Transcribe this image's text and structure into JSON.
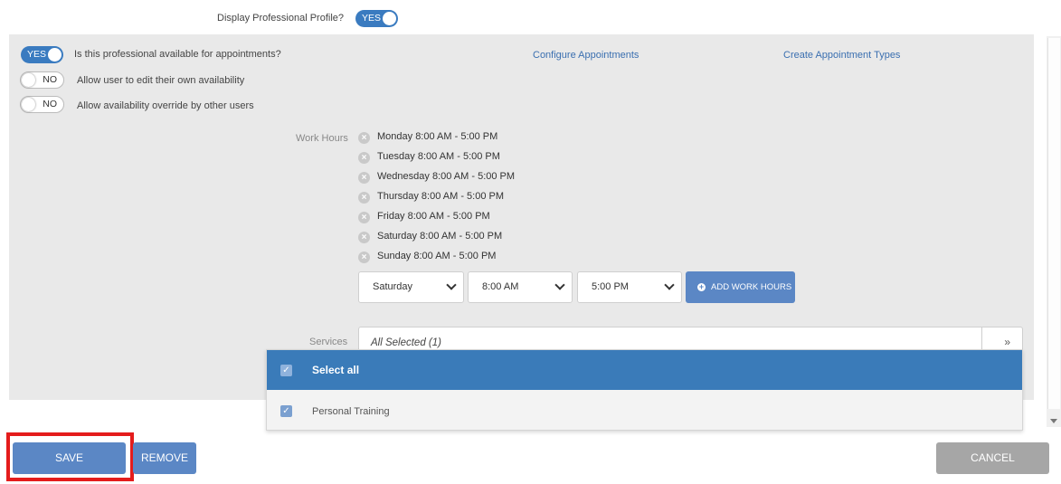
{
  "profile": {
    "display_label": "Display Professional Profile?",
    "display_toggle": "YES"
  },
  "availability": {
    "available_toggle": "YES",
    "available_label": "Is this professional available for appointments?",
    "edit_toggle": "NO",
    "edit_label": "Allow user to edit their own availability",
    "override_toggle": "NO",
    "override_label": "Allow availability override by other users",
    "configure_link": "Configure Appointments",
    "create_types_link": "Create Appointment Types"
  },
  "work_hours": {
    "label": "Work Hours",
    "entries": [
      "Monday 8:00 AM - 5:00 PM",
      "Tuesday 8:00 AM - 5:00 PM",
      "Wednesday 8:00 AM - 5:00 PM",
      "Thursday 8:00 AM - 5:00 PM",
      "Friday 8:00 AM - 5:00 PM",
      "Saturday 8:00 AM - 5:00 PM",
      "Sunday 8:00 AM - 5:00 PM"
    ],
    "day_select": "Saturday",
    "start_select": "8:00 AM",
    "end_select": "5:00 PM",
    "add_button": "ADD WORK HOURS"
  },
  "services": {
    "label": "Services",
    "value": "All Selected (1)",
    "select_all": "Select all",
    "options": [
      "Personal Training"
    ]
  },
  "footer": {
    "save": "SAVE",
    "remove": "REMOVE",
    "cancel": "CANCEL"
  },
  "colors": {
    "accent": "#3a7bc0",
    "button": "#5b87c5",
    "cancel": "#a6a6a6",
    "highlight": "#e41c1c"
  }
}
